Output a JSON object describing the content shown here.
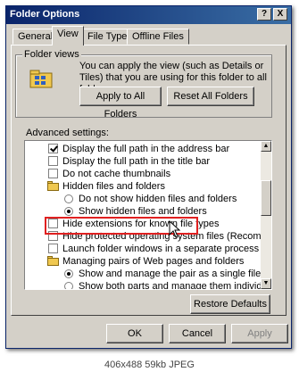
{
  "window": {
    "title": "Folder Options",
    "help_button": "?",
    "close_button": "X"
  },
  "tabs": [
    {
      "label": "General"
    },
    {
      "label": "View"
    },
    {
      "label": "File Types"
    },
    {
      "label": "Offline Files"
    }
  ],
  "folder_views": {
    "group_label": "Folder views",
    "description": "You can apply the view (such as Details or Tiles) that you are using for this folder to all folders.",
    "apply_all_label": "Apply to All Folders",
    "reset_all_label": "Reset All Folders"
  },
  "advanced": {
    "label": "Advanced settings:",
    "items": [
      {
        "kind": "checkbox",
        "checked": true,
        "label": "Display the full path in the address bar"
      },
      {
        "kind": "checkbox",
        "checked": false,
        "label": "Display the full path in the title bar"
      },
      {
        "kind": "checkbox",
        "checked": false,
        "label": "Do not cache thumbnails"
      },
      {
        "kind": "folder",
        "label": "Hidden files and folders"
      },
      {
        "kind": "radio",
        "checked": false,
        "label": "Do not show hidden files and folders"
      },
      {
        "kind": "radio",
        "checked": true,
        "label": "Show hidden files and folders"
      },
      {
        "kind": "checkbox",
        "checked": false,
        "label": "Hide extensions for known file types"
      },
      {
        "kind": "checkbox",
        "checked": false,
        "label": "Hide protected operating system files (Recommended)"
      },
      {
        "kind": "checkbox",
        "checked": false,
        "label": "Launch folder windows in a separate process"
      },
      {
        "kind": "folder",
        "label": "Managing pairs of Web pages and folders"
      },
      {
        "kind": "radio",
        "checked": true,
        "label": "Show and manage the pair as a single file"
      },
      {
        "kind": "radio",
        "checked": false,
        "label": "Show both parts and manage them individually"
      }
    ],
    "restore_label": "Restore Defaults"
  },
  "footer": {
    "ok_label": "OK",
    "cancel_label": "Cancel",
    "apply_label": "Apply"
  },
  "caption": "406x488 59kb JPEG",
  "colors": {
    "title_bar": "#0a246a",
    "dialog_bg": "#d4d0c8",
    "highlight_box": "#e02020"
  }
}
